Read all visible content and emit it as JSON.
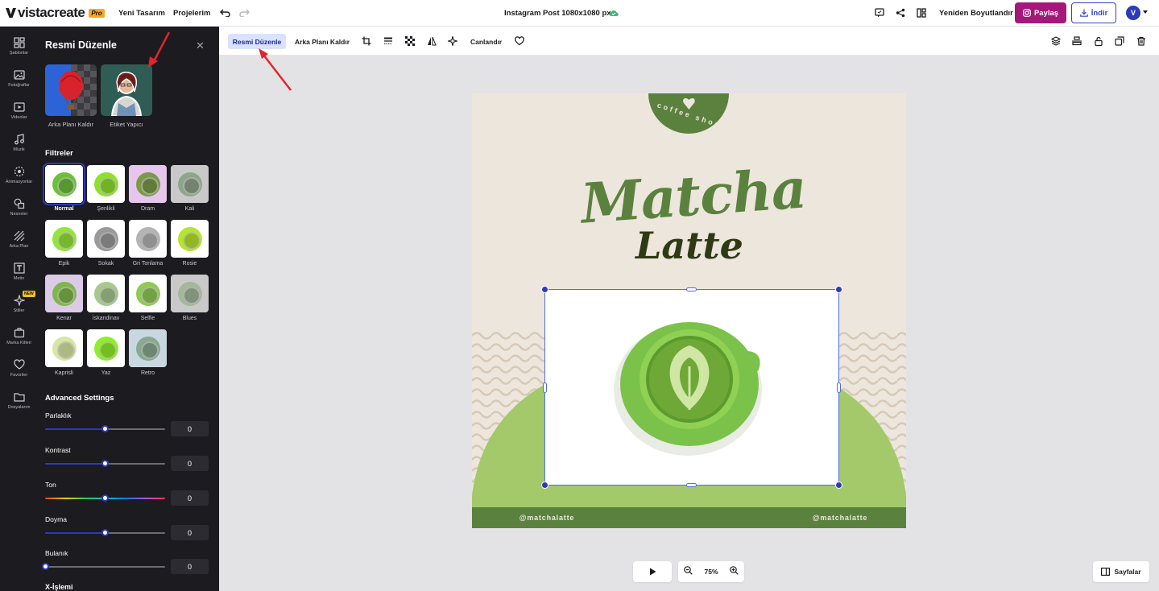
{
  "topbar": {
    "logo": "vistacreate",
    "pro_badge": "Pro",
    "new_design": "Yeni Tasarım",
    "projects": "Projelerim",
    "doc_title": "Instagram Post 1080x1080 px",
    "resize": "Yeniden Boyutlandır",
    "share": "Paylaş",
    "download": "İndir",
    "avatar_letter": "V"
  },
  "rail": [
    {
      "label": "Şablonlar",
      "icon": "templates-icon"
    },
    {
      "label": "Fotoğraflar",
      "icon": "photos-icon"
    },
    {
      "label": "Videolar",
      "icon": "videos-icon"
    },
    {
      "label": "Müzik",
      "icon": "music-icon"
    },
    {
      "label": "Animasyonlar",
      "icon": "animations-icon"
    },
    {
      "label": "Nesneler",
      "icon": "objects-icon"
    },
    {
      "label": "Arka Plan",
      "icon": "background-icon"
    },
    {
      "label": "Metin",
      "icon": "text-icon"
    },
    {
      "label": "Stiller",
      "icon": "styles-icon",
      "badge": "NEW"
    },
    {
      "label": "Marka Kitleri",
      "icon": "brand-kit-icon"
    },
    {
      "label": "Favoriler",
      "icon": "heart-icon"
    },
    {
      "label": "Dosyalarım",
      "icon": "folder-icon"
    }
  ],
  "panel": {
    "title": "Resmi Düzenle",
    "tools": [
      {
        "label": "Arka Planı Kaldır"
      },
      {
        "label": "Etiket Yapıcı"
      }
    ],
    "filters_title": "Filtreler",
    "filters": [
      {
        "label": "Normal",
        "color": "#6cbf3a"
      },
      {
        "label": "Şenlikli",
        "color": "#8fe02c"
      },
      {
        "label": "Dram",
        "color": "#7a9a4a"
      },
      {
        "label": "Kali",
        "color": "#8fa58a"
      },
      {
        "label": "Epik",
        "color": "#93e637"
      },
      {
        "label": "Sokak",
        "color": "#9a9a9a"
      },
      {
        "label": "Gri Tonlama",
        "color": "#b4b4b4"
      },
      {
        "label": "Rosie",
        "color": "#b6e52e"
      },
      {
        "label": "Kenar",
        "color": "#7fb64a"
      },
      {
        "label": "İskandinav",
        "color": "#a6c98d"
      },
      {
        "label": "Selfie",
        "color": "#8fca55"
      },
      {
        "label": "Blues",
        "color": "#a4b79a"
      },
      {
        "label": "Kaprisli",
        "color": "#d8e6a4"
      },
      {
        "label": "Yaz",
        "color": "#8df026"
      },
      {
        "label": "Retro",
        "color": "#88a990"
      }
    ],
    "advanced_title": "Advanced Settings",
    "sliders": [
      {
        "label": "Parlaklık",
        "value": "0",
        "level": 0.5
      },
      {
        "label": "Kontrast",
        "value": "0",
        "level": 0.5
      },
      {
        "label": "Ton",
        "value": "0",
        "level": 0.5
      },
      {
        "label": "Doyma",
        "value": "0",
        "level": 0.5
      },
      {
        "label": "Bulanık",
        "value": "0",
        "level": 0.0
      }
    ],
    "next_section": "X-İşlemi"
  },
  "toolbar": {
    "edit_image": "Resmi Düzenle",
    "remove_bg": "Arka Planı Kaldır",
    "animate": "Canlandır"
  },
  "design": {
    "badge_text": "coffee shop",
    "title_line1": "Matcha",
    "title_line2": "Latte",
    "handle_left": "@matchalatte",
    "handle_right": "@matchalatte",
    "green_dark": "#5a823e",
    "green_light": "#a3c96a"
  },
  "bottom": {
    "zoom": "75%",
    "pages": "Sayfalar"
  }
}
